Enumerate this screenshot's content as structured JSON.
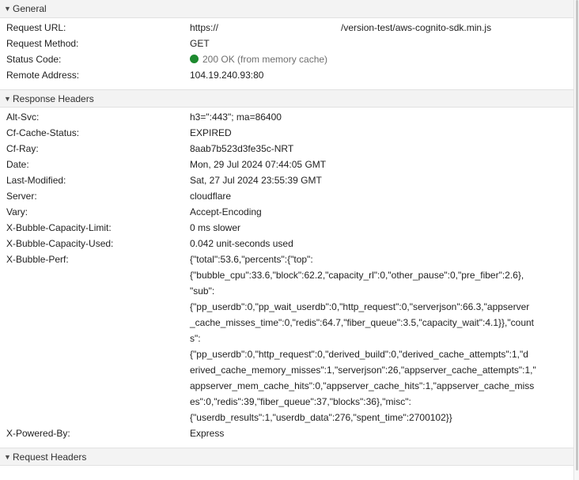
{
  "general": {
    "title": "General",
    "rows": [
      {
        "name": "Request URL:",
        "value_start": "https://",
        "value_end": "/version-test/aws-cognito-sdk.min.js"
      },
      {
        "name": "Request Method:",
        "value": "GET"
      },
      {
        "name": "Status Code:",
        "value": "200 OK (from memory cache)",
        "status_color": "#1d8a2f"
      },
      {
        "name": "Remote Address:",
        "value": "104.19.240.93:80"
      }
    ]
  },
  "response_headers": {
    "title": "Response Headers",
    "rows": [
      {
        "name": "Alt-Svc:",
        "value": "h3=\":443\"; ma=86400"
      },
      {
        "name": "Cf-Cache-Status:",
        "value": "EXPIRED"
      },
      {
        "name": "Cf-Ray:",
        "value": "8aab7b523d3fe35c-NRT"
      },
      {
        "name": "Date:",
        "value": "Mon, 29 Jul 2024 07:44:05 GMT"
      },
      {
        "name": "Last-Modified:",
        "value": "Sat, 27 Jul 2024 23:55:39 GMT"
      },
      {
        "name": "Server:",
        "value": "cloudflare"
      },
      {
        "name": "Vary:",
        "value": "Accept-Encoding"
      },
      {
        "name": "X-Bubble-Capacity-Limit:",
        "value": "0 ms slower"
      },
      {
        "name": "X-Bubble-Capacity-Used:",
        "value": "0.042 unit-seconds used"
      },
      {
        "name": "X-Bubble-Perf:",
        "value_lines": [
          "{\"total\":53.6,\"percents\":{\"top\":",
          "{\"bubble_cpu\":33.6,\"block\":62.2,\"capacity_rl\":0,\"other_pause\":0,\"pre_fiber\":2.6},",
          "\"sub\":",
          "{\"pp_userdb\":0,\"pp_wait_userdb\":0,\"http_request\":0,\"serverjson\":66.3,\"appserver",
          "_cache_misses_time\":0,\"redis\":64.7,\"fiber_queue\":3.5,\"capacity_wait\":4.1}},\"count",
          "s\":",
          "{\"pp_userdb\":0,\"http_request\":0,\"derived_build\":0,\"derived_cache_attempts\":1,\"d",
          "erived_cache_memory_misses\":1,\"serverjson\":26,\"appserver_cache_attempts\":1,\"",
          "appserver_mem_cache_hits\":0,\"appserver_cache_hits\":1,\"appserver_cache_miss",
          "es\":0,\"redis\":39,\"fiber_queue\":37,\"blocks\":36},\"misc\":",
          "{\"userdb_results\":1,\"userdb_data\":276,\"spent_time\":2700102}}"
        ]
      },
      {
        "name": "X-Powered-By:",
        "value": "Express"
      }
    ]
  },
  "request_headers": {
    "title": "Request Headers"
  },
  "icons": {
    "expanded": "▼"
  }
}
